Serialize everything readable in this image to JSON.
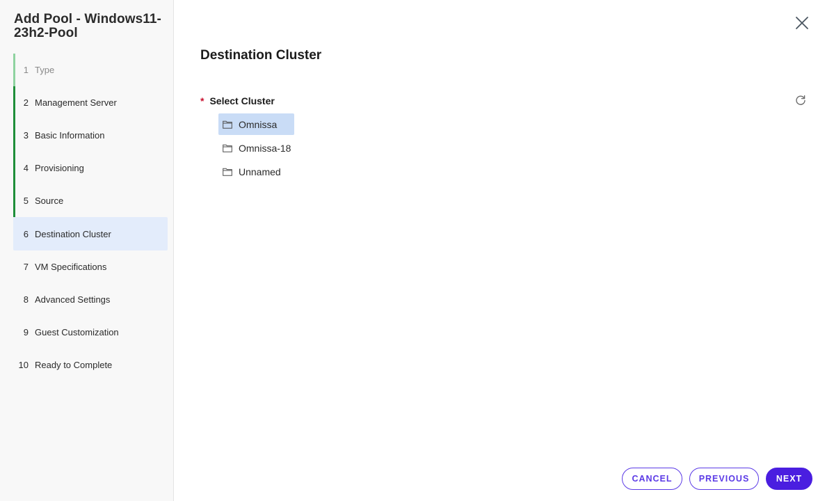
{
  "wizard": {
    "title": "Add Pool - Windows11-23h2-Pool",
    "steps": [
      {
        "num": "1",
        "label": "Type"
      },
      {
        "num": "2",
        "label": "Management Server"
      },
      {
        "num": "3",
        "label": "Basic Information"
      },
      {
        "num": "4",
        "label": "Provisioning"
      },
      {
        "num": "5",
        "label": "Source"
      },
      {
        "num": "6",
        "label": "Destination Cluster"
      },
      {
        "num": "7",
        "label": "VM Specifications"
      },
      {
        "num": "8",
        "label": "Advanced Settings"
      },
      {
        "num": "9",
        "label": "Guest Customization"
      },
      {
        "num": "10",
        "label": "Ready to Complete"
      }
    ],
    "current_step": "6"
  },
  "main": {
    "title": "Destination Cluster",
    "field": {
      "required_mark": "*",
      "label": "Select Cluster"
    },
    "clusters": [
      {
        "label": "Omnissa",
        "selected": true
      },
      {
        "label": "Omnissa-18",
        "selected": false
      },
      {
        "label": "Unnamed",
        "selected": false
      }
    ]
  },
  "footer": {
    "cancel_label": "CANCEL",
    "previous_label": "PREVIOUS",
    "next_label": "NEXT"
  },
  "colors": {
    "accent": "#4a1ee0",
    "step_done": "#1f8f3a",
    "step_current_bg": "#e3ecfb",
    "selection_bg": "#c9dcf6",
    "required": "#c8102e"
  },
  "icons": {
    "close": "close-icon",
    "refresh": "refresh-icon",
    "folder": "folder-icon"
  }
}
